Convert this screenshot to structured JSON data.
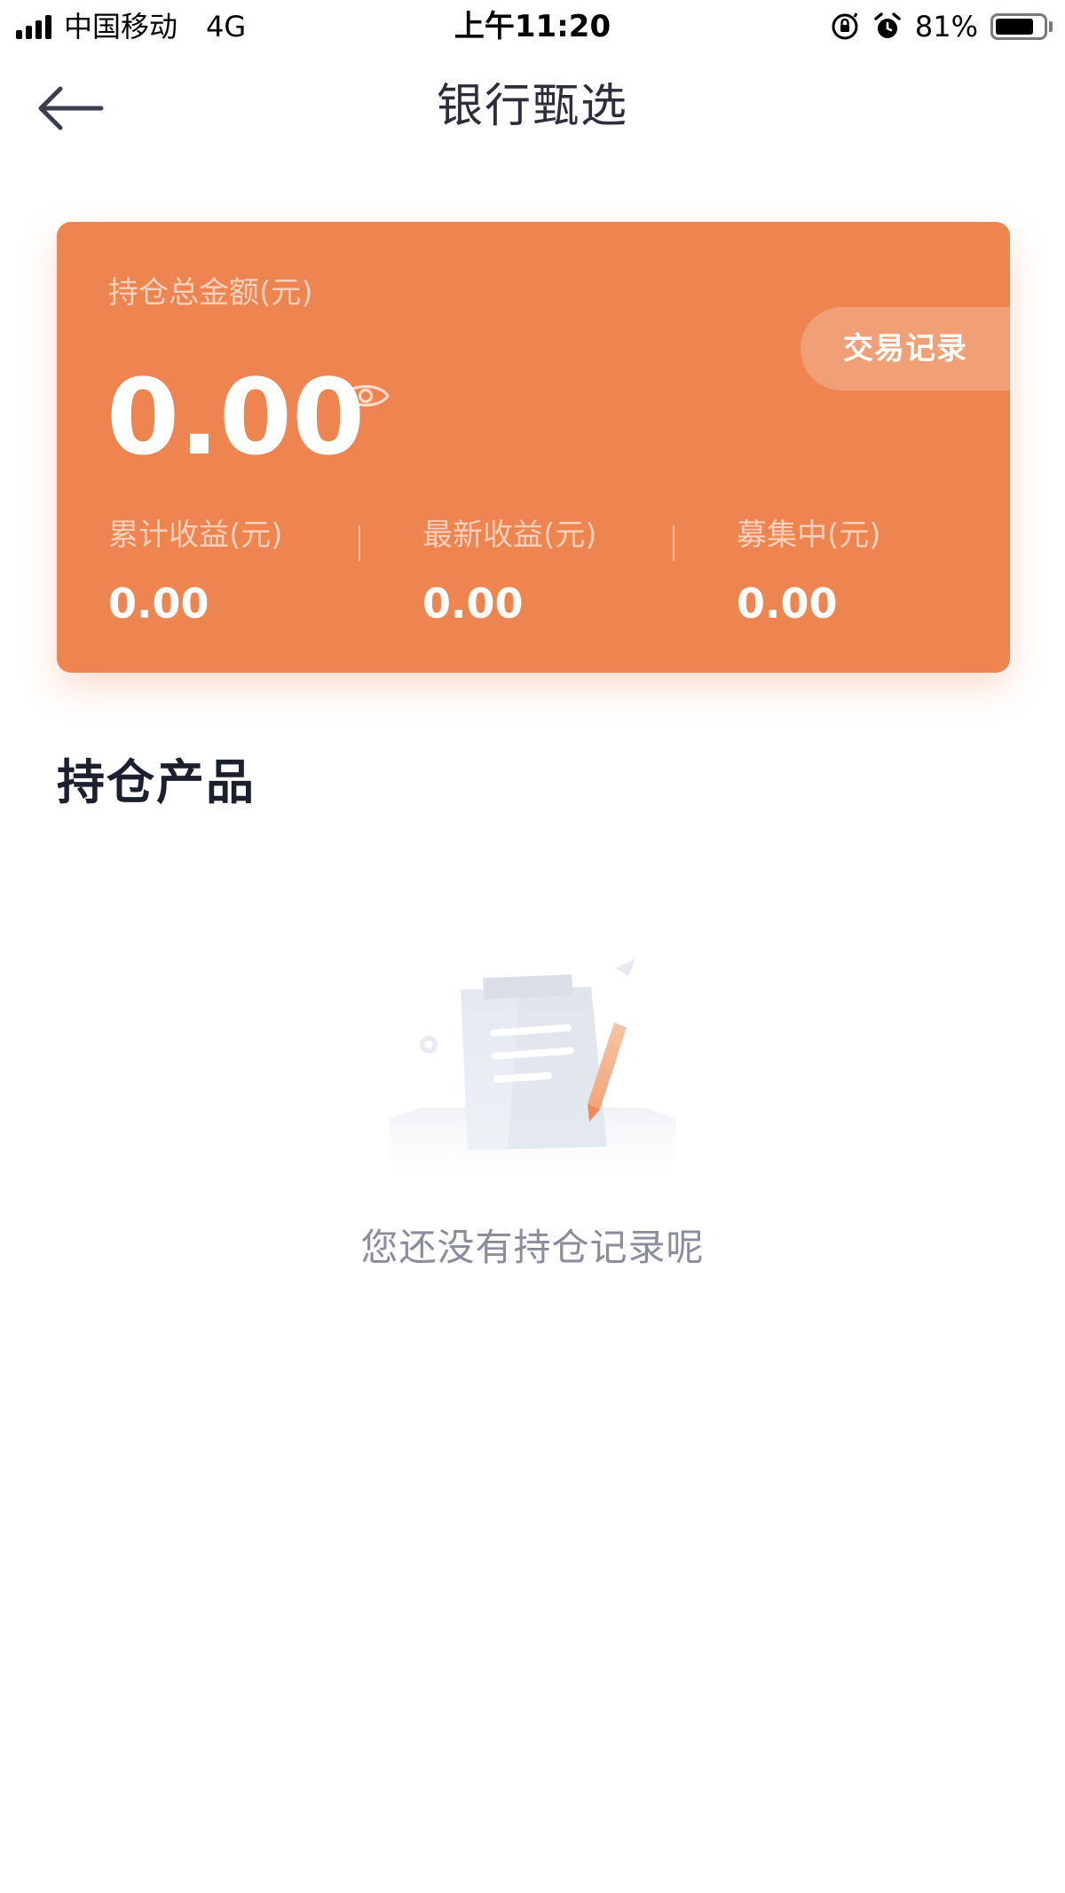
{
  "status_bar": {
    "carrier": "中国移动",
    "network": "4G",
    "time": "上午11:20",
    "battery_percent": "81%",
    "battery_level": 0.81
  },
  "nav": {
    "title": "银行甄选"
  },
  "summary": {
    "total_label": "持仓总金额(元)",
    "total_value": "0.00",
    "trade_record_label": "交易记录",
    "stats": [
      {
        "label": "累计收益(元)",
        "value": "0.00"
      },
      {
        "label": "最新收益(元)",
        "value": "0.00"
      },
      {
        "label": "募集中(元)",
        "value": "0.00"
      }
    ]
  },
  "holdings": {
    "section_title": "持仓产品",
    "empty_message": "您还没有持仓记录呢"
  },
  "colors": {
    "card_bg": "#ee8550",
    "title_text": "#1c1f2e",
    "muted_text": "#8a8d9c"
  },
  "icons": {
    "back": "arrow-left-icon",
    "visibility": "eye-icon",
    "empty_state": "clipboard-pencil-icon"
  }
}
